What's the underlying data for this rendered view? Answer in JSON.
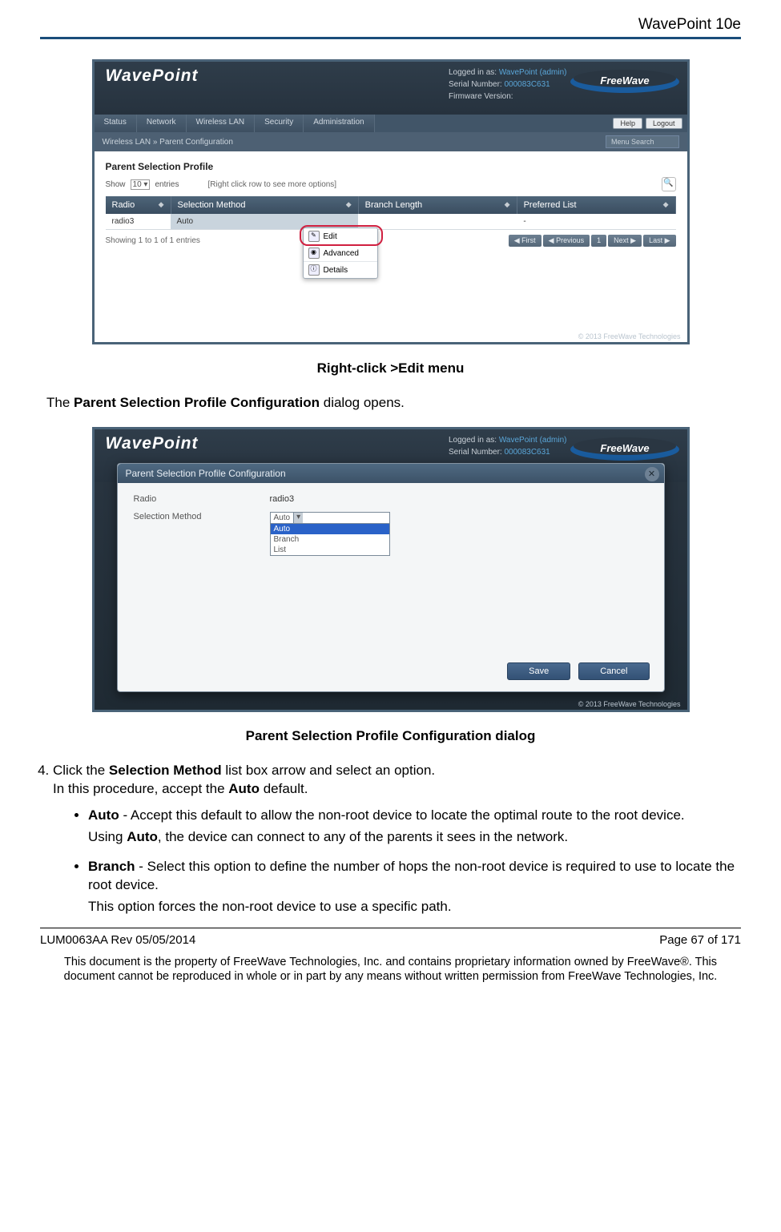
{
  "header": {
    "product": "WavePoint 10e"
  },
  "shot1": {
    "logo": "WavePoint",
    "sub": "",
    "meta_logged": "Logged in as:",
    "meta_logged_v": "WavePoint (admin)",
    "meta_serial": "Serial Number:",
    "meta_serial_v": "000083C631",
    "meta_fw": "Firmware Version:",
    "freewave": "FreeWave",
    "tabs": [
      "Status",
      "Network",
      "Wireless LAN",
      "Security",
      "Administration"
    ],
    "help": "Help",
    "logout": "Logout",
    "crumb": "Wireless LAN  »  Parent Configuration",
    "menusearch": "Menu Search",
    "panel": "Parent Selection Profile",
    "show": "Show",
    "entries_n": "10",
    "entries": "entries",
    "hint": "[Right click row to see more options]",
    "th": [
      "Radio",
      "Selection Method",
      "Branch Length",
      "Preferred List"
    ],
    "row": [
      "radio3",
      "Auto",
      "",
      "-"
    ],
    "footer": "Showing 1 to 1 of 1 entries",
    "pag": [
      "◀ First",
      "◀ Previous",
      "1",
      "Next ▶",
      "Last ▶"
    ],
    "ctx": [
      "Edit",
      "Advanced",
      "Details"
    ],
    "copy": "© 2013 FreeWave Technologies"
  },
  "caption1": "Right-click >Edit menu",
  "text1_a": "The ",
  "text1_b": "Parent Selection Profile Configuration",
  "text1_c": " dialog opens.",
  "shot2": {
    "dlg_title": "Parent Selection Profile Configuration",
    "radio_l": "Radio",
    "radio_v": "radio3",
    "sel_l": "Selection Method",
    "sel_v": "Auto",
    "opts": [
      "Auto",
      "Branch",
      "List"
    ],
    "save": "Save",
    "cancel": "Cancel",
    "copy": "© 2013 FreeWave Technologies"
  },
  "caption2": "Parent Selection Profile Configuration dialog",
  "step4": {
    "num": "4.",
    "l1a": "Click the ",
    "l1b": "Selection Method",
    "l1c": " list box arrow and select an option.",
    "l2a": "In this procedure, accept the ",
    "l2b": "Auto",
    "l2c": " default.",
    "b1a": "Auto",
    "b1b": " - Accept this default to allow the non-root device to locate the optimal route to the root device.",
    "b1c": "Using ",
    "b1d": "Auto",
    "b1e": ", the device can connect to any of the parents it sees in the network.",
    "b2a": "Branch",
    "b2b": " - Select this option to define the number of hops the non-root device is required to use to locate the root device.",
    "b2c": "This option forces the non-root device to use a specific path."
  },
  "footer": {
    "left": "LUM0063AA Rev 05/05/2014",
    "right": "Page 67 of 171",
    "note": "This document is the property of FreeWave Technologies, Inc. and contains proprietary information owned by FreeWave®. This document cannot be reproduced in whole or in part by any means without written permission from FreeWave Technologies, Inc."
  }
}
